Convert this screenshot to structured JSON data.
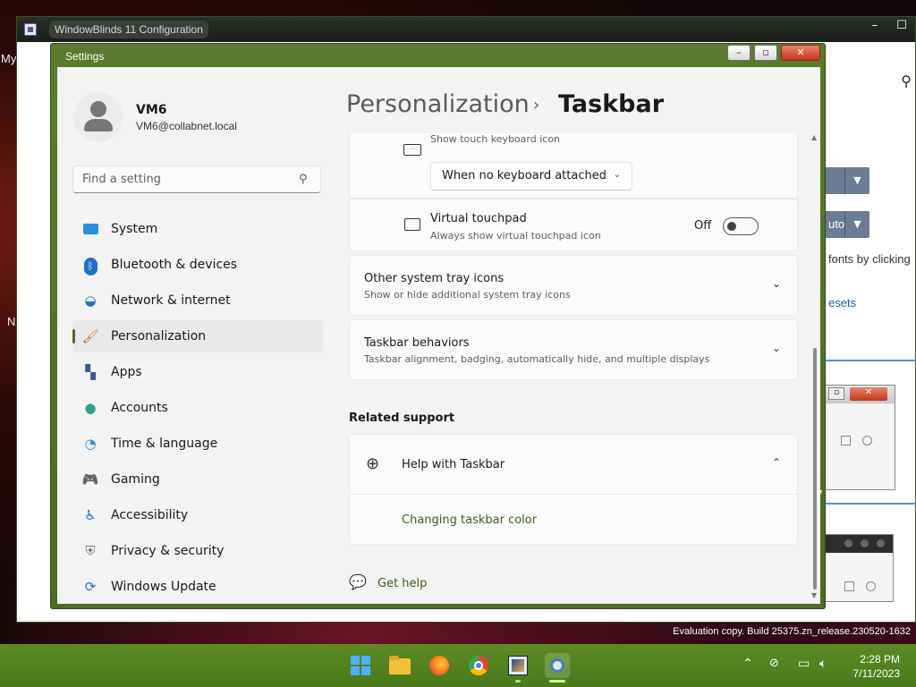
{
  "background_window": {
    "title": "WindowBlinds 11 Configuration",
    "combo2_value": "uto",
    "text_fonts": "fonts by clicking",
    "text_presets": "esets"
  },
  "desktop": {
    "left_text_1": "My",
    "left_text_2": "N"
  },
  "settings_window": {
    "title": "Settings",
    "user": {
      "name": "VM6",
      "email": "VM6@collabnet.local"
    },
    "search": {
      "placeholder": "Find a setting"
    },
    "nav": [
      {
        "label": "System",
        "icon": "system-icon"
      },
      {
        "label": "Bluetooth & devices",
        "icon": "bluetooth-icon"
      },
      {
        "label": "Network & internet",
        "icon": "wifi-icon"
      },
      {
        "label": "Personalization",
        "icon": "brush-icon",
        "active": true
      },
      {
        "label": "Apps",
        "icon": "apps-icon"
      },
      {
        "label": "Accounts",
        "icon": "account-icon"
      },
      {
        "label": "Time & language",
        "icon": "globe-clock-icon"
      },
      {
        "label": "Gaming",
        "icon": "gamepad-icon"
      },
      {
        "label": "Accessibility",
        "icon": "accessibility-icon"
      },
      {
        "label": "Privacy & security",
        "icon": "shield-icon"
      },
      {
        "label": "Windows Update",
        "icon": "update-icon"
      }
    ],
    "breadcrumb": {
      "parent": "Personalization",
      "separator": "›",
      "current": "Taskbar"
    },
    "touch_keyboard": {
      "subtitle": "Show touch keyboard icon",
      "dropdown_value": "When no keyboard attached"
    },
    "virtual_touchpad": {
      "title": "Virtual touchpad",
      "subtitle": "Always show virtual touchpad icon",
      "state_label": "Off"
    },
    "other_tray": {
      "title": "Other system tray icons",
      "subtitle": "Show or hide additional system tray icons"
    },
    "behaviors": {
      "title": "Taskbar behaviors",
      "subtitle": "Taskbar alignment, badging, automatically hide, and multiple displays"
    },
    "related_support": {
      "heading": "Related support",
      "help_title": "Help with Taskbar",
      "link": "Changing taskbar color"
    },
    "get_help": "Get help"
  },
  "watermark": "Evaluation copy. Build 25375.zn_release.230520-1632",
  "taskbar": {
    "apps": [
      "windows-start-icon",
      "file-explorer-icon",
      "firefox-icon",
      "chrome-icon",
      "windowblinds-icon",
      "settings-icon"
    ],
    "clock_time": "2:28 PM",
    "clock_date": "7/11/2023"
  },
  "colors": {
    "accent": "#4e6b24",
    "taskbar": "#5c8a24",
    "link": "#3e5c16"
  }
}
